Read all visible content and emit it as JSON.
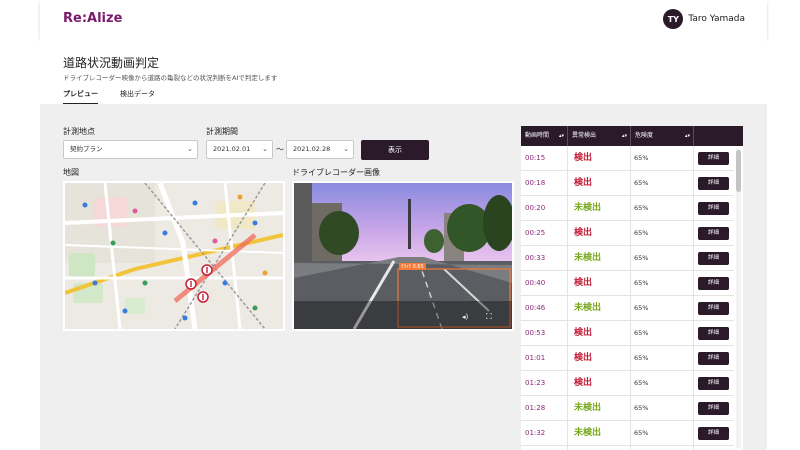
{
  "app": {
    "logo": "Re:Alize"
  },
  "user": {
    "initials": "TY",
    "name": "Taro Yamada"
  },
  "page": {
    "title": "道路状況動画判定",
    "subtitle": "ドライブレコーダー映像から道路の亀裂などの状況判断をAIで判定します"
  },
  "tabs": [
    {
      "label": "プレビュー",
      "active": true
    },
    {
      "label": "検出データ",
      "active": false
    }
  ],
  "filters": {
    "location_label": "計測地点",
    "location_value": "契約プラン",
    "period_label": "計測期間",
    "start_date": "2021.02.01",
    "separator": "～",
    "end_date": "2021.02.28",
    "show_button": "表示"
  },
  "map": {
    "label": "地図"
  },
  "dashcam": {
    "label": "ドライブレコーダー画像",
    "detection_label": "ｸﾗｯｸ 0.65"
  },
  "table": {
    "headers": [
      "動画時間",
      "異常検出",
      "危険度",
      ""
    ],
    "detail_label": "詳細",
    "rows": [
      {
        "time": "00:15",
        "status": "検出",
        "risk": "65%"
      },
      {
        "time": "00:18",
        "status": "検出",
        "risk": "65%"
      },
      {
        "time": "00:20",
        "status": "未検出",
        "risk": "65%"
      },
      {
        "time": "00:25",
        "status": "検出",
        "risk": "65%"
      },
      {
        "time": "00:33",
        "status": "未検出",
        "risk": "65%"
      },
      {
        "time": "00:40",
        "status": "検出",
        "risk": "65%"
      },
      {
        "time": "00:46",
        "status": "未検出",
        "risk": "65%"
      },
      {
        "time": "00:53",
        "status": "検出",
        "risk": "65%"
      },
      {
        "time": "01:01",
        "status": "検出",
        "risk": "65%"
      },
      {
        "time": "01:23",
        "status": "検出",
        "risk": "65%"
      },
      {
        "time": "01:28",
        "status": "未検出",
        "risk": "65%"
      },
      {
        "time": "01:32",
        "status": "未検出",
        "risk": "65%"
      }
    ]
  },
  "colors": {
    "brand": "#7a1a6b",
    "dark": "#2a1a2a",
    "detected": "#c2203a",
    "not_detected": "#7aa81e"
  },
  "icons": {
    "select_chevron": "chevron-down-icon",
    "sort": "sort-icon",
    "map_marker": "map-pin-icon"
  }
}
